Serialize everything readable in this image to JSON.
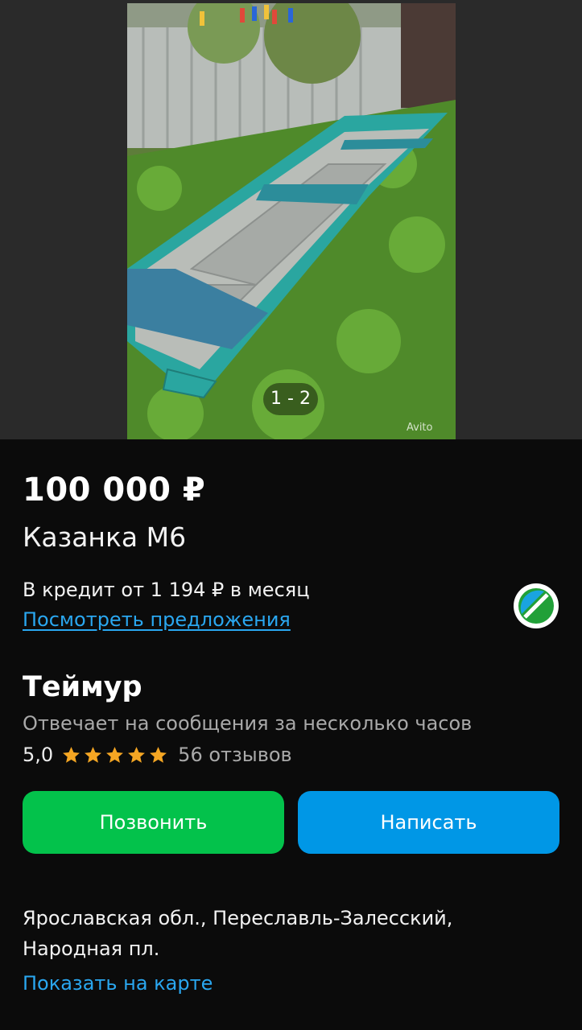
{
  "gallery": {
    "counter": "1 - 2",
    "watermark": "Avito"
  },
  "listing": {
    "price": "100 000 ₽",
    "title": "Казанка М6",
    "credit_text": "В кредит от 1 194 ₽ в месяц",
    "offers_link": "Посмотреть предложения",
    "bank_logo_icon": "sber-logo-icon"
  },
  "seller": {
    "name": "Теймур",
    "response_time": "Отвечает на сообщения за несколько часов",
    "rating": "5,0",
    "stars": 5,
    "reviews": "56 отзывов"
  },
  "actions": {
    "call_label": "Позвонить",
    "write_label": "Написать"
  },
  "location": {
    "address_line1": "Ярославская обл., Переславль-Залесский,",
    "address_line2": "Народная пл.",
    "map_link": "Показать на карте"
  },
  "colors": {
    "background": "#0b0b0b",
    "call_button": "#03c24b",
    "write_button": "#0097e6",
    "link": "#2aa7f0",
    "star": "#f5a623"
  }
}
